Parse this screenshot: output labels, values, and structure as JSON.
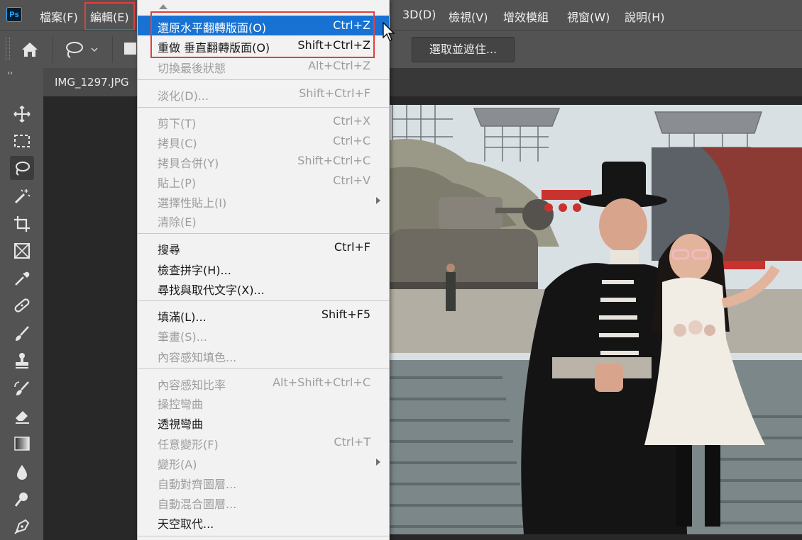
{
  "app": {
    "logo_text": "Ps"
  },
  "menubar": {
    "items": [
      "檔案(F)",
      "編輯(E)",
      "3D(D)",
      "檢視(V)",
      "增效模組",
      "視窗(W)",
      "說明(H)"
    ]
  },
  "options_bar": {
    "select_mask_label": "選取並遮住..."
  },
  "document": {
    "tab_title": "IMG_1297.JPG"
  },
  "edit_menu": {
    "items": [
      {
        "label": "還原水平翻轉版面(O)",
        "shortcut": "Ctrl+Z",
        "state": "highlighted"
      },
      {
        "label": "重做 垂直翻轉版面(O)",
        "shortcut": "Shift+Ctrl+Z",
        "state": "enabled"
      },
      {
        "label": "切換最後狀態",
        "shortcut": "Alt+Ctrl+Z",
        "state": "disabled"
      },
      {
        "label": "淡化(D)...",
        "shortcut": "Shift+Ctrl+F",
        "state": "disabled"
      },
      {
        "label": "剪下(T)",
        "shortcut": "Ctrl+X",
        "state": "disabled"
      },
      {
        "label": "拷貝(C)",
        "shortcut": "Ctrl+C",
        "state": "disabled"
      },
      {
        "label": "拷貝合併(Y)",
        "shortcut": "Shift+Ctrl+C",
        "state": "disabled"
      },
      {
        "label": "貼上(P)",
        "shortcut": "Ctrl+V",
        "state": "disabled"
      },
      {
        "label": "選擇性貼上(I)",
        "shortcut": "",
        "state": "disabled",
        "submenu": true
      },
      {
        "label": "清除(E)",
        "shortcut": "",
        "state": "disabled"
      },
      {
        "label": "搜尋",
        "shortcut": "Ctrl+F",
        "state": "enabled"
      },
      {
        "label": "檢查拼字(H)...",
        "shortcut": "",
        "state": "enabled"
      },
      {
        "label": "尋找與取代文字(X)...",
        "shortcut": "",
        "state": "enabled"
      },
      {
        "label": "填滿(L)...",
        "shortcut": "Shift+F5",
        "state": "enabled"
      },
      {
        "label": "筆畫(S)...",
        "shortcut": "",
        "state": "disabled"
      },
      {
        "label": "內容感知填色...",
        "shortcut": "",
        "state": "disabled"
      },
      {
        "label": "內容感知比率",
        "shortcut": "Alt+Shift+Ctrl+C",
        "state": "disabled"
      },
      {
        "label": "操控彎曲",
        "shortcut": "",
        "state": "disabled"
      },
      {
        "label": "透視彎曲",
        "shortcut": "",
        "state": "enabled"
      },
      {
        "label": "任意變形(F)",
        "shortcut": "Ctrl+T",
        "state": "disabled"
      },
      {
        "label": "變形(A)",
        "shortcut": "",
        "state": "disabled",
        "submenu": true
      },
      {
        "label": "自動對齊圖層...",
        "shortcut": "",
        "state": "disabled"
      },
      {
        "label": "自動混合圖層...",
        "shortcut": "",
        "state": "disabled"
      },
      {
        "label": "天空取代...",
        "shortcut": "",
        "state": "enabled"
      }
    ]
  },
  "toolbar": {
    "tools": [
      "move-icon",
      "marquee-icon",
      "lasso-icon",
      "magic-wand-icon",
      "crop-icon",
      "frame-icon",
      "eyedropper-icon",
      "healing-brush-icon",
      "brush-icon",
      "clone-stamp-icon",
      "history-brush-icon",
      "eraser-icon",
      "gradient-icon",
      "blur-icon",
      "dodge-icon",
      "pen-icon"
    ]
  },
  "colors": {
    "highlight": "#1872d3",
    "annotation_red": "#e0403c",
    "ui_gray": "#535353"
  }
}
